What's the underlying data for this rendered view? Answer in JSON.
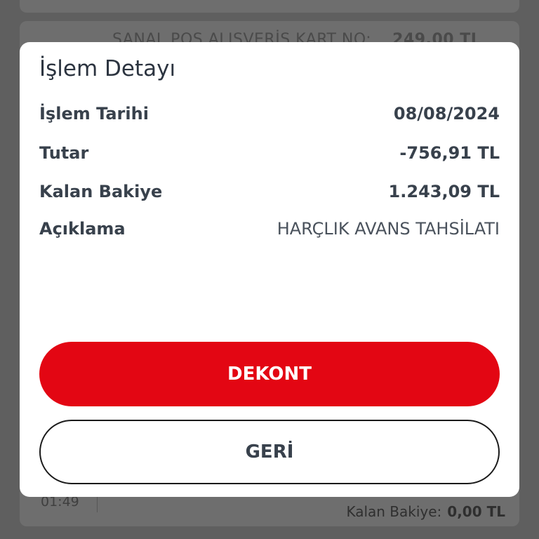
{
  "background": {
    "row1_label": "SANAL POS ALIŞVERİŞ KART NO:",
    "row1_amount": "249,00 TL",
    "time": "01:49",
    "balance_label": "Kalan Bakiye:",
    "balance_value": "0,00 TL"
  },
  "dialog": {
    "title": "İşlem Detayı",
    "rows": [
      {
        "label": "İşlem Tarihi",
        "value": "08/08/2024"
      },
      {
        "label": "Tutar",
        "value": "-756,91 TL"
      },
      {
        "label": "Kalan Bakiye",
        "value": "1.243,09 TL"
      },
      {
        "label": "Açıklama",
        "value": "HARÇLIK AVANS TAHSİLATI"
      }
    ],
    "primary_button": "DEKONT",
    "secondary_button": "GERİ"
  },
  "colors": {
    "accent": "#e30613",
    "text": "#38414c",
    "overlay": "#5f5f5f"
  }
}
